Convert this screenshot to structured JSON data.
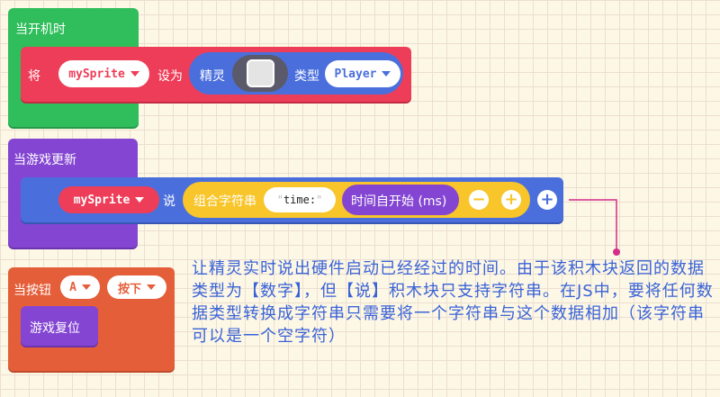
{
  "block_start": {
    "hat_label": "当开机时",
    "set_label": "将",
    "variable": "mySprite",
    "set_as": "设为",
    "sprite_label": "精灵",
    "type_label": "类型",
    "kind": "Player"
  },
  "block_update": {
    "hat_label": "当游戏更新",
    "variable": "mySprite",
    "say_label": "说",
    "join_label": "组合字符串",
    "string_value": "time:",
    "time_label": "时间自开始 (ms)",
    "minus": "−",
    "plus": "+"
  },
  "block_button": {
    "hat_label": "当按钮",
    "button": "A",
    "event": "按下",
    "action_label": "游戏复位"
  },
  "annotation": {
    "text": "让精灵实时说出硬件启动已经经过的时间。由于该积木块返回的数据类型为【数字】，但【说】积木块只支持字符串。在JS中，要将任何数据类型转换成字符串只需要将一个字符串与这个数据相加（该字符串可以是一个空字符）"
  },
  "colors": {
    "loops_green": "#2fbe5b",
    "sprites_red": "#ee3d58",
    "sprites_blue": "#4a6fdc",
    "game_purple": "#8446d2",
    "text_yellow": "#f8c52a",
    "controller_orange": "#e55e3a",
    "annotation_line": "#d42d8a"
  }
}
